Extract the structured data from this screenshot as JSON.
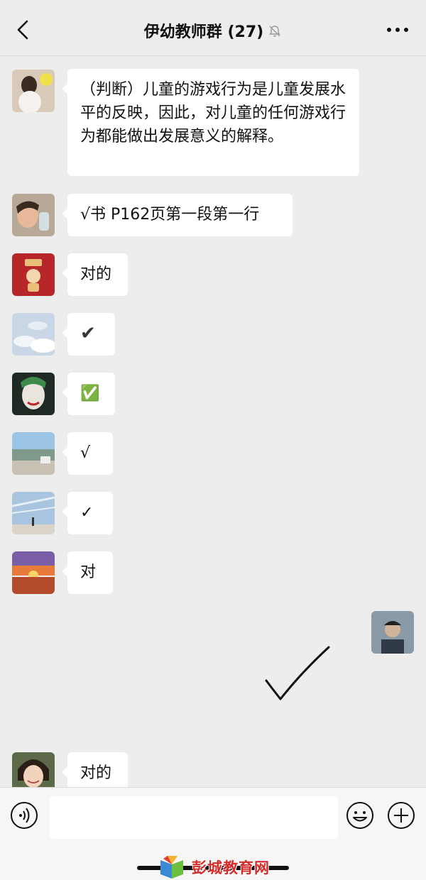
{
  "header": {
    "title": "伊幼教师群 (27)",
    "back_icon": "chevron-left-icon",
    "mute_icon": "bell-off-icon",
    "more_icon": "more-icon"
  },
  "messages": [
    {
      "sender": "other",
      "avatar": "avatar-girl-with-balloon",
      "text": "（判断）儿童的游戏行为是儿童发展水平的反映，因此，对儿童的任何游戏行为都能做出发展意义的解释。"
    },
    {
      "sender": "other",
      "avatar": "avatar-child-drinking",
      "text": "√书 P162页第一段第一行"
    },
    {
      "sender": "other",
      "avatar": "avatar-red-cartoon",
      "text": "对的"
    },
    {
      "sender": "other",
      "avatar": "avatar-sky-clouds",
      "text": "✔"
    },
    {
      "sender": "other",
      "avatar": "avatar-joker",
      "text": "✅"
    },
    {
      "sender": "other",
      "avatar": "avatar-beach-scene",
      "text": "√"
    },
    {
      "sender": "other",
      "avatar": "avatar-sky-person",
      "text": "✓"
    },
    {
      "sender": "other",
      "avatar": "avatar-sunset",
      "text": "对"
    },
    {
      "sender": "me",
      "avatar": "avatar-man-cap",
      "content": "handwritten-check-mark"
    },
    {
      "sender": "other",
      "avatar": "avatar-child-smiling",
      "text": "对的"
    }
  ],
  "input_bar": {
    "voice_icon": "voice-icon",
    "input_value": "",
    "emoji_icon": "emoji-icon",
    "plus_icon": "plus-icon"
  },
  "watermark": {
    "text": "彭城教育网"
  },
  "colors": {
    "background": "#ededed",
    "bubble": "#ffffff",
    "check_green": "#2dbd4e"
  }
}
